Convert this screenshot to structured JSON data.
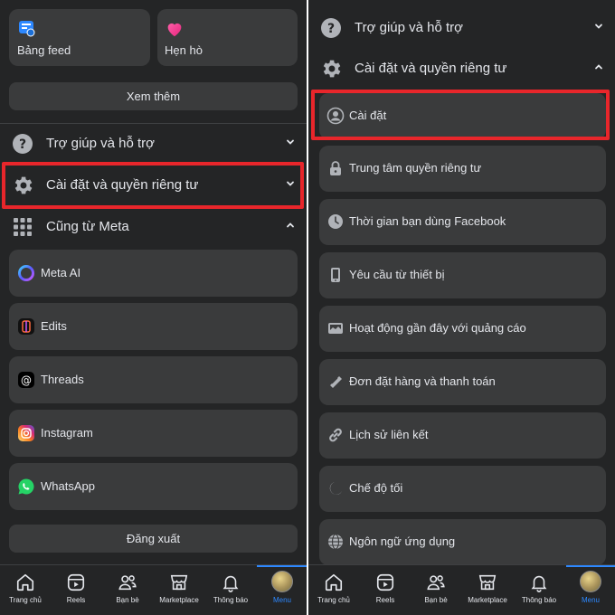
{
  "left": {
    "shortcuts": [
      {
        "label": "Bảng feed",
        "icon": "feed-icon"
      },
      {
        "label": "Hẹn hò",
        "icon": "heart-icon"
      }
    ],
    "see_more": "Xem thêm",
    "help": {
      "label": "Trợ giúp và hỗ trợ",
      "icon": "help-icon"
    },
    "settings": {
      "label": "Cài đặt và quyền riêng tư",
      "icon": "gear-icon"
    },
    "also_from_meta": {
      "label": "Cũng từ Meta",
      "icon": "apps-grid-icon"
    },
    "meta_apps": [
      {
        "label": "Meta AI",
        "icon": "meta-ai-icon"
      },
      {
        "label": "Edits",
        "icon": "edits-icon"
      },
      {
        "label": "Threads",
        "icon": "threads-icon"
      },
      {
        "label": "Instagram",
        "icon": "instagram-icon"
      },
      {
        "label": "WhatsApp",
        "icon": "whatsapp-icon"
      }
    ],
    "logout": "Đăng xuất"
  },
  "right": {
    "help": {
      "label": "Trợ giúp và hỗ trợ",
      "icon": "help-icon"
    },
    "settings": {
      "label": "Cài đặt và quyền riêng tư",
      "icon": "gear-icon"
    },
    "items": [
      {
        "label": "Cài đặt",
        "icon": "profile-icon"
      },
      {
        "label": "Trung tâm quyền riêng tư",
        "icon": "lock-icon"
      },
      {
        "label": "Thời gian bạn dùng Facebook",
        "icon": "clock-icon"
      },
      {
        "label": "Yêu cầu từ thiết bị",
        "icon": "device-icon"
      },
      {
        "label": "Hoạt động gần đây với quảng cáo",
        "icon": "ad-activity-icon"
      },
      {
        "label": "Đơn đặt hàng và thanh toán",
        "icon": "payment-icon"
      },
      {
        "label": "Lịch sử liên kết",
        "icon": "link-icon"
      },
      {
        "label": "Chế độ tối",
        "icon": "moon-icon"
      },
      {
        "label": "Ngôn ngữ ứng dụng",
        "icon": "globe-icon"
      }
    ]
  },
  "nav": [
    {
      "label": "Trang chủ",
      "icon": "home-icon"
    },
    {
      "label": "Reels",
      "icon": "reels-icon"
    },
    {
      "label": "Bạn bè",
      "icon": "friends-icon"
    },
    {
      "label": "Marketplace",
      "icon": "marketplace-icon"
    },
    {
      "label": "Thông báo",
      "icon": "bell-icon"
    },
    {
      "label": "Menu",
      "icon": "avatar"
    }
  ],
  "colors": {
    "background": "#242526",
    "card": "#3a3b3c",
    "text": "#e4e6eb",
    "highlight": "#e8262b",
    "active": "#2d88ff"
  }
}
